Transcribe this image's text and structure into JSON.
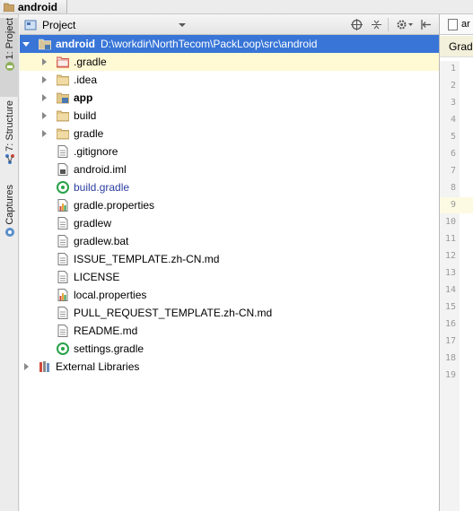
{
  "breadcrumb": {
    "label": "android"
  },
  "toolstrip": {
    "tabs": [
      {
        "label": "1: Project",
        "icon": "project-icon"
      },
      {
        "label": "7: Structure",
        "icon": "structure-icon"
      },
      {
        "label": "Captures",
        "icon": "captures-icon"
      }
    ]
  },
  "panel": {
    "view_selector": "Project",
    "buttons": [
      "target-icon",
      "collapse-all-icon",
      "gear-icon",
      "hide-panel-icon"
    ]
  },
  "tree": {
    "root": {
      "label": "android",
      "path": "D:\\workdir\\NorthTecom\\PackLoop\\src\\android"
    },
    "items": [
      {
        "label": ".gradle",
        "icon": "folder-red-icon",
        "expandable": true
      },
      {
        "label": ".idea",
        "icon": "folder-icon",
        "expandable": true
      },
      {
        "label": "app",
        "icon": "module-folder-icon",
        "expandable": true,
        "bold": true
      },
      {
        "label": "build",
        "icon": "folder-icon",
        "expandable": true
      },
      {
        "label": "gradle",
        "icon": "folder-icon",
        "expandable": true
      },
      {
        "label": ".gitignore",
        "icon": "file-icon",
        "expandable": false
      },
      {
        "label": "android.iml",
        "icon": "iml-file-icon",
        "expandable": false
      },
      {
        "label": "build.gradle",
        "icon": "gradle-icon",
        "expandable": false,
        "blue": true
      },
      {
        "label": "gradle.properties",
        "icon": "properties-icon",
        "expandable": false
      },
      {
        "label": "gradlew",
        "icon": "file-icon",
        "expandable": false
      },
      {
        "label": "gradlew.bat",
        "icon": "file-icon",
        "expandable": false
      },
      {
        "label": "ISSUE_TEMPLATE.zh-CN.md",
        "icon": "file-icon",
        "expandable": false
      },
      {
        "label": "LICENSE",
        "icon": "file-icon",
        "expandable": false
      },
      {
        "label": "local.properties",
        "icon": "properties-icon",
        "expandable": false
      },
      {
        "label": "PULL_REQUEST_TEMPLATE.zh-CN.md",
        "icon": "file-icon",
        "expandable": false
      },
      {
        "label": "README.md",
        "icon": "file-icon",
        "expandable": false
      },
      {
        "label": "settings.gradle",
        "icon": "gradle-icon",
        "expandable": false
      }
    ],
    "external": {
      "label": "External Libraries",
      "icon": "libraries-icon"
    }
  },
  "editor": {
    "tab_label": "ar",
    "breadcrumb": "Gradl",
    "line_numbers": [
      "1",
      "2",
      "3",
      "4",
      "5",
      "6",
      "7",
      "8",
      "9",
      "10",
      "11",
      "12",
      "13",
      "14",
      "15",
      "16",
      "17",
      "18",
      "19"
    ],
    "current_line": "9"
  },
  "colors": {
    "selection": "#3875d7",
    "highlight_row": "#fff9d4",
    "blue_text": "#2a3ea0",
    "folder": "#c8a165",
    "folder_red": "#d04a3a"
  }
}
